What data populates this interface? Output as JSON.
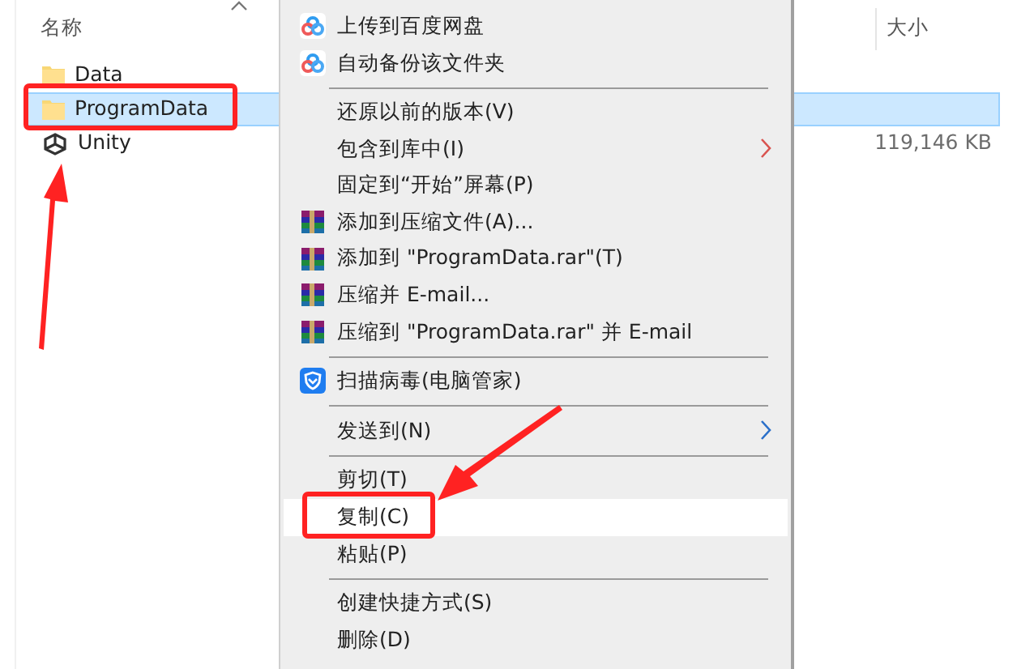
{
  "explorer": {
    "columns": [
      {
        "label": "名称",
        "sorted": true
      },
      {
        "label": "大小"
      }
    ],
    "rows": [
      {
        "name": "Data",
        "kind": "folder",
        "selected": false
      },
      {
        "name": "ProgramData",
        "kind": "folder",
        "selected": true
      },
      {
        "name": "Unity",
        "kind": "unity",
        "selected": false,
        "size": "119,146 KB"
      }
    ]
  },
  "context_menu": {
    "items": [
      {
        "kind": "cloud",
        "label": "上传到百度网盘"
      },
      {
        "kind": "cloud",
        "label": "自动备份该文件夹"
      },
      {
        "kind": "separator"
      },
      {
        "kind": "plain",
        "label": "还原以前的版本(V)"
      },
      {
        "kind": "plain",
        "label": "包含到库中(I)",
        "submenu": true,
        "color": "#d9534f"
      },
      {
        "kind": "plain",
        "label": "固定到“开始”屏幕(P)"
      },
      {
        "kind": "archive",
        "label": "添加到压缩文件(A)..."
      },
      {
        "kind": "archive",
        "label": "添加到 \"ProgramData.rar\"(T)"
      },
      {
        "kind": "archive",
        "label": "压缩并 E-mail..."
      },
      {
        "kind": "archive",
        "label": "压缩到 \"ProgramData.rar\" 并 E-mail"
      },
      {
        "kind": "separator"
      },
      {
        "kind": "shield",
        "label": "扫描病毒(电脑管家)"
      },
      {
        "kind": "separator"
      },
      {
        "kind": "plain",
        "label": "发送到(N)",
        "submenu": true,
        "color": "#2a6fc9"
      },
      {
        "kind": "separator"
      },
      {
        "kind": "plain",
        "label": "剪切(T)"
      },
      {
        "kind": "plain",
        "label": "复制(C)",
        "highlighted": true
      },
      {
        "kind": "plain",
        "label": "粘贴(P)"
      },
      {
        "kind": "separator"
      },
      {
        "kind": "plain",
        "label": "创建快捷方式(S)"
      },
      {
        "kind": "plain",
        "label": "删除(D)"
      }
    ]
  }
}
